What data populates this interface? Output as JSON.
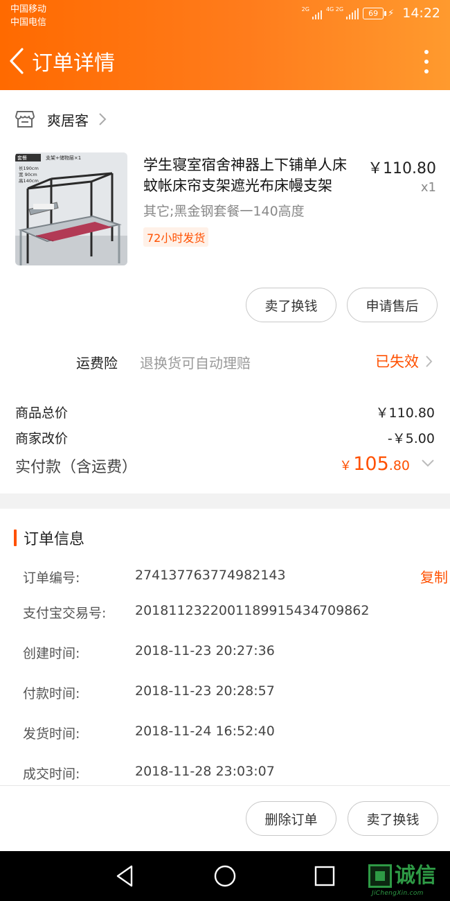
{
  "status_bar": {
    "carrier1": "中国移动",
    "carrier2": "中国电信",
    "net1": "2G",
    "net2": "4G 2G",
    "battery": "69",
    "time": "14:22"
  },
  "header": {
    "title": "订单详情",
    "back_icon": "chevron-left-icon",
    "more_icon": "more-vertical-icon",
    "gradient_start": "#ff6a00",
    "gradient_end": "#ff9a2e"
  },
  "shop": {
    "name": "爽居客",
    "icon": "store-icon"
  },
  "product": {
    "title": "学生寝室宿舍神器上下铺单人床蚊帐床帘支架遮光布床幔支架",
    "price": "￥110.80",
    "quantity": "x1",
    "spec": "其它;黑金钢套餐一140高度",
    "shipping_tag": "72小时发货",
    "image_labels": [
      "套餐",
      "支架+储物层×1",
      "长190cm",
      "宽 90cm",
      "高140cm"
    ]
  },
  "item_actions": {
    "sell": "卖了换钱",
    "after_sale": "申请售后"
  },
  "insurance": {
    "label": "运费险",
    "description": "退换货可自动理赔",
    "status": "已失效"
  },
  "summary": {
    "goods_total_label": "商品总价",
    "goods_total_value": "￥110.80",
    "adjust_label": "商家改价",
    "adjust_value": "-￥5.00",
    "paid_label": "实付款（含运费）",
    "paid_currency": "￥",
    "paid_integer": "105",
    "paid_decimal": ".80"
  },
  "order_info": {
    "title": "订单信息",
    "copy_label": "复制",
    "rows": [
      {
        "label": "订单编号:",
        "value": "274137763774982143"
      },
      {
        "label": "支付宝交易号:",
        "value": "2018112322001189915434709862"
      },
      {
        "label": "创建时间:",
        "value": "2018-11-23 20:27:36"
      },
      {
        "label": "付款时间:",
        "value": "2018-11-23 20:28:57"
      },
      {
        "label": "发货时间:",
        "value": "2018-11-24 16:52:40"
      },
      {
        "label": "成交时间:",
        "value": "2018-11-28 23:03:07"
      }
    ]
  },
  "bottom_actions": {
    "delete": "删除订单",
    "sell": "卖了换钱"
  },
  "system_nav": {
    "back_icon": "triangle-back-icon",
    "home_icon": "circle-home-icon",
    "recents_icon": "square-recents-icon"
  },
  "watermark": {
    "text": "诚信",
    "sub": "JiChengXin.com"
  },
  "colors": {
    "accent": "#ff5000",
    "muted": "#999999",
    "divider": "#f2f2f2"
  }
}
